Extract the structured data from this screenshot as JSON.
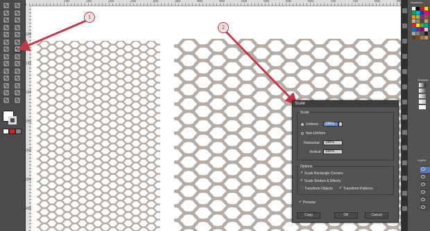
{
  "ruler": {
    "top_numbers": [
      "100",
      "150",
      "200",
      "250",
      "300",
      "350",
      "400",
      "450",
      "500",
      "550",
      "600",
      "650",
      "700",
      "750",
      "800",
      "850",
      "900"
    ],
    "left_numbers": [
      "100",
      "150",
      "200",
      "250",
      "300",
      "350",
      "400"
    ]
  },
  "callouts": {
    "one": "1",
    "two": "2"
  },
  "colors": {
    "arrow": "#c0394b",
    "pattern": "#b5aca6",
    "dialog_bg": "#535353"
  },
  "right_panel": {
    "tabs": [
      "Swatches",
      "Gradient",
      "Layers"
    ]
  },
  "dialog": {
    "title": "Scale",
    "scale_group_label": "Scale",
    "uniform_label": "Uniform:",
    "uniform_value": "195%",
    "non_uniform_label": "Non-Uniform",
    "horizontal_label": "Horizontal:",
    "horizontal_value": "195%",
    "vertical_label": "Vertical:",
    "vertical_value": "195%",
    "options_label": "Options",
    "scale_rect_corners": "Scale Rectangle Corners",
    "scale_strokes": "Scale Strokes & Effects",
    "transform_objects": "Transform Objects",
    "transform_patterns": "Transform Patterns",
    "preview": "Preview",
    "copy_button": "Copy",
    "ok_button": "OK",
    "cancel_button": "Cancel"
  }
}
